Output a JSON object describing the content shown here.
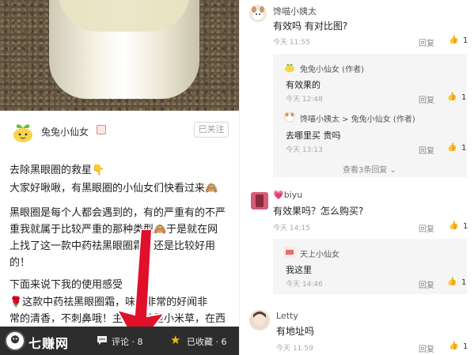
{
  "colors": {
    "like_red": "#e04848",
    "bottom_bar": "#2d2d2d",
    "arrow_red": "#e0102a",
    "star_yellow": "#f5b800"
  },
  "post": {
    "author": "兔兔小仙女",
    "follow_label": "已关注",
    "title": "去除黑眼圈的救星👇",
    "p1": "大家好啾啾，有黑眼圈的小仙女们快看过来🙈",
    "p2_lines": [
      "黑眼圈是每个人都会遇到的，有的严重有的不严",
      "重我就属于比较严重的那种类型🙈于是就在网",
      "上找了这一款中药祛黑眼圈霜，还是比较好用",
      "的！"
    ],
    "p3": "下面来说下我的使用感受",
    "p4_lines": [
      "🌹这款中药祛黑眼圈霜，味道非常的好闻非",
      "常的清香，不刺鼻哦！主要成分是小米草，在西",
      "..."
    ]
  },
  "bottom_bar": {
    "brand": "七赚网",
    "comment_label": "评论 · 8",
    "fav_label": "已收藏 · 6",
    "icons": [
      "brand-logo-icon",
      "comment-icon",
      "star-icon"
    ]
  },
  "comments": [
    {
      "name": "馋喵小姨太",
      "text": "有效吗 有对比图?",
      "time": "今天 11:55",
      "reply": "回复",
      "likes": "1",
      "replies": [
        {
          "name": "兔兔小仙女 (作者)",
          "text": "有效果的",
          "time": "今天 12:48",
          "reply": "回复",
          "likes": "1"
        },
        {
          "name": "馋喵小姨太 > 兔兔小仙女 (作者)",
          "text": "去哪里买 贵吗",
          "time": "今天 13:13",
          "reply": "回复",
          "likes": "1"
        }
      ],
      "view_more": "查看3条回复 ⌄"
    },
    {
      "name": "💗biyu",
      "text": "有效果吗？怎么购买?",
      "time": "今天 14:15",
      "reply": "回复",
      "likes": "1",
      "replies": [
        {
          "name": "天上小仙女",
          "text": "我这里",
          "time": "今天 14:46",
          "reply": "回复",
          "likes": "1"
        }
      ]
    },
    {
      "name": "Letty",
      "text": "有地址吗",
      "time": "今天 11:59",
      "reply": "回复",
      "likes": "1",
      "replies": []
    }
  ]
}
